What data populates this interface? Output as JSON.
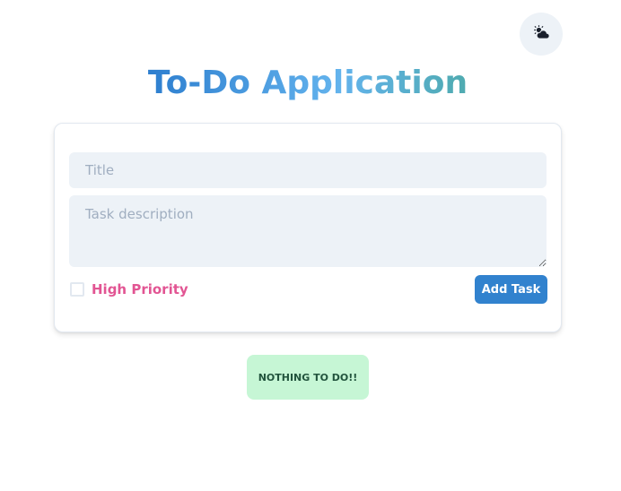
{
  "header": {
    "title": "To-Do Application",
    "theme_toggle_icon": "cloud-sun-icon"
  },
  "form": {
    "title_placeholder": "Title",
    "title_value": "",
    "description_placeholder": "Task description",
    "description_value": "",
    "priority_label": "High Priority",
    "priority_checked": false,
    "add_button_label": "Add Task"
  },
  "tasks": {
    "empty_message": "NOTHING TO DO!!"
  },
  "colors": {
    "accent": "#3182ce",
    "priority": "#e25593",
    "empty_bg": "#c6f6d5",
    "empty_text": "#22543d"
  }
}
